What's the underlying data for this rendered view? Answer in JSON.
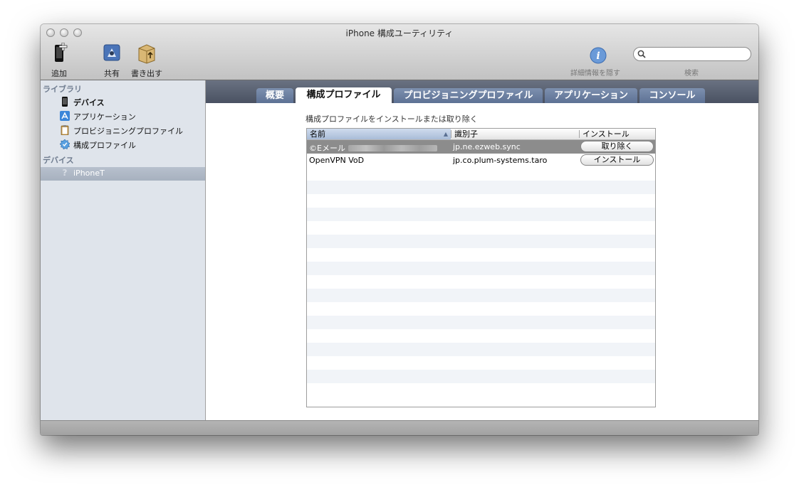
{
  "window": {
    "title": "iPhone 構成ユーティリティ"
  },
  "toolbar": {
    "add_label": "追加",
    "share_label": "共有",
    "export_label": "書き出す",
    "hide_details_label": "詳細情報を隠す",
    "search_label": "検索",
    "search_value": "",
    "search_placeholder": ""
  },
  "sidebar": {
    "library_header": "ライブラリ",
    "library_items": [
      {
        "label": "デバイス",
        "icon": "iphone-icon"
      },
      {
        "label": "アプリケーション",
        "icon": "app-store-icon"
      },
      {
        "label": "プロビジョニングプロファイル",
        "icon": "clipboard-icon"
      },
      {
        "label": "構成プロファイル",
        "icon": "gear-badge-icon"
      }
    ],
    "devices_header": "デバイス",
    "device_items": [
      {
        "label": "iPhoneT",
        "icon": "question-icon",
        "selected": true
      }
    ]
  },
  "tabs": [
    {
      "label": "概要"
    },
    {
      "label": "構成プロファイル",
      "active": true
    },
    {
      "label": "プロビジョニングプロファイル"
    },
    {
      "label": "アプリケーション"
    },
    {
      "label": "コンソール"
    }
  ],
  "main": {
    "header_text": "構成プロファイルをインストールまたは取り除く"
  },
  "table": {
    "columns": [
      "名前",
      "識別子",
      "インストール"
    ],
    "sorted_column": "名前",
    "rows": [
      {
        "name": "©Eメール",
        "identifier": "jp.ne.ezweb.sync",
        "action": "取り除く",
        "selected": true
      },
      {
        "name": "OpenVPN VoD",
        "identifier": "jp.co.plum-systems.taro",
        "action": "インストール",
        "selected": false
      }
    ]
  },
  "colors": {
    "tab_bar": "#4f5767",
    "tab_inactive": "#6f83a4",
    "selected_row": "#8c8c8c",
    "sidebar_bg": "#dfe4eb",
    "sidebar_header": "#6f7c8f"
  }
}
